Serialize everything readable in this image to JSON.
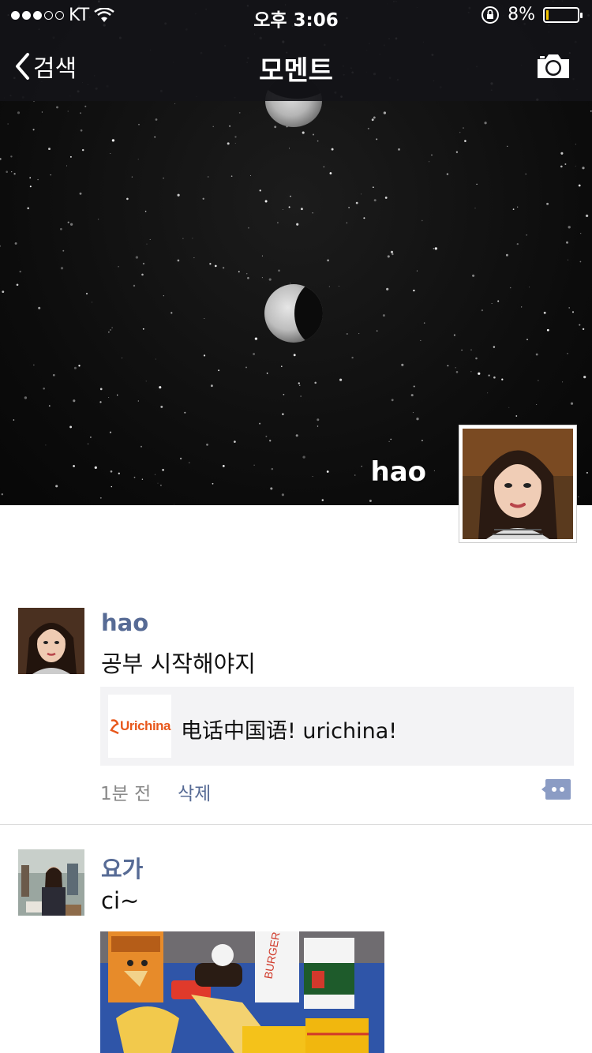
{
  "status": {
    "carrier": "KT",
    "time": "오후 3:06",
    "battery": "8%",
    "battery_level": 0.08,
    "signal_bars": 3
  },
  "nav": {
    "back_label": "검색",
    "title": "모멘트"
  },
  "profile": {
    "name": "hao"
  },
  "posts": [
    {
      "name": "hao",
      "text": "공부 시작해야지",
      "link": {
        "thumb_label": "Urichina",
        "title": "电话中国语! urichina!"
      },
      "time": "1분 전",
      "delete_label": "삭제"
    },
    {
      "name": "요가",
      "text": "ci~"
    }
  ],
  "colors": {
    "link_name": "#576b95",
    "battery_fill": "#f2c400",
    "nav_bg": "#141418"
  }
}
